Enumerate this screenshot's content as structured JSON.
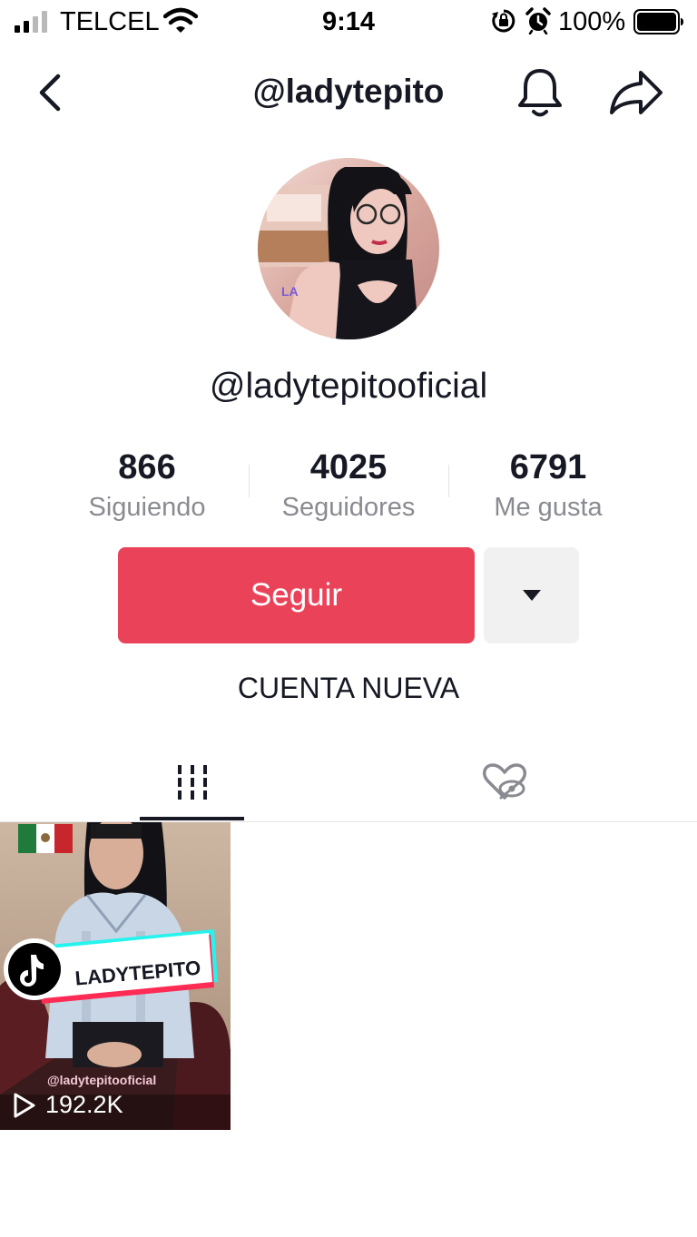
{
  "status_bar": {
    "carrier": "TELCEL",
    "time": "9:14",
    "battery_percent": "100%"
  },
  "nav": {
    "title": "@ladytepito"
  },
  "profile": {
    "username": "@ladytepitooficial",
    "avatar_badge": "LA",
    "stats": [
      {
        "value": "866",
        "label": "Siguiendo"
      },
      {
        "value": "4025",
        "label": "Seguidores"
      },
      {
        "value": "6791",
        "label": "Me gusta"
      }
    ],
    "follow_label": "Seguir",
    "bio": "CUENTA NUEVA"
  },
  "tabs": {
    "active": "videos"
  },
  "videos": [
    {
      "sticker_text": "LADYTEPITO",
      "handle_overlay": "@ladytepitooficial",
      "play_count": "192.2K"
    }
  ],
  "colors": {
    "accent": "#ea4359",
    "text_primary": "#161823",
    "text_secondary": "#8a8b91",
    "button_secondary": "#f1f1f2"
  }
}
